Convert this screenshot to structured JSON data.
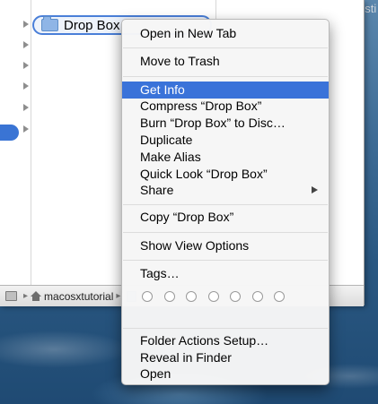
{
  "desktop": {
    "label": "esti"
  },
  "finder": {
    "selected_item": "Drop Box",
    "path_bar": [
      "macosxtutorial"
    ]
  },
  "menu": {
    "groups": [
      {
        "items": [
          {
            "label": "Open in New Tab"
          }
        ]
      },
      {
        "items": [
          {
            "label": "Move to Trash"
          }
        ]
      },
      {
        "items": [
          {
            "label": "Get Info",
            "highlighted": true
          },
          {
            "label": "Compress “Drop Box”"
          },
          {
            "label": "Burn “Drop Box” to Disc…"
          },
          {
            "label": "Duplicate"
          },
          {
            "label": "Make Alias"
          },
          {
            "label": "Quick Look “Drop Box”"
          },
          {
            "label": "Share",
            "submenu": true
          }
        ]
      },
      {
        "items": [
          {
            "label": "Copy “Drop Box”"
          }
        ]
      },
      {
        "items": [
          {
            "label": "Show View Options"
          }
        ]
      },
      {
        "items": [
          {
            "label": "Tags…"
          }
        ]
      },
      {
        "items": [
          {
            "label": "Folder Actions Setup…"
          },
          {
            "label": "Reveal in Finder"
          },
          {
            "label": "Open"
          }
        ]
      }
    ],
    "tag_colors": [
      "#ffffff",
      "#ffffff",
      "#ffffff",
      "#ffffff",
      "#ffffff",
      "#ffffff",
      "#ffffff"
    ]
  },
  "colors": {
    "highlight": "#3a73d9",
    "selection_border": "#4a7fd8"
  }
}
